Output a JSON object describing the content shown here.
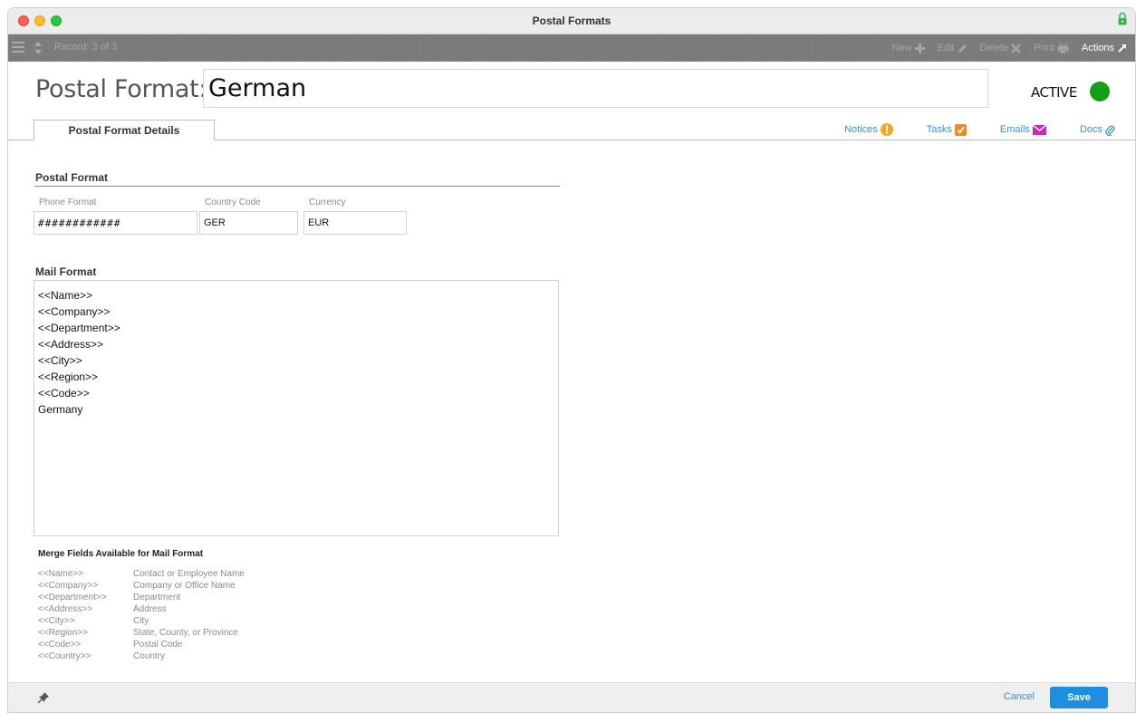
{
  "window": {
    "title": "Postal Formats"
  },
  "toolbar": {
    "record_text": "Record: 3 of 3",
    "new_label": "New",
    "edit_label": "Edit",
    "delete_label": "Delete",
    "print_label": "Print",
    "actions_label": "Actions"
  },
  "header": {
    "label": "Postal Format:",
    "name_value": "German",
    "status_label": "ACTIVE",
    "status_color": "#14a014"
  },
  "tabs": {
    "active_tab": "Postal Format Details",
    "links": [
      {
        "label": "Notices",
        "icon": "exclamation-icon",
        "color": "#f5a623"
      },
      {
        "label": "Tasks",
        "icon": "checkbox-icon",
        "color": "#f08a1c"
      },
      {
        "label": "Emails",
        "icon": "envelope-icon",
        "color": "#c12fb8"
      },
      {
        "label": "Docs",
        "icon": "paperclip-icon",
        "color": "#3e8fd6"
      }
    ]
  },
  "postal_format": {
    "section_title": "Postal Format",
    "phone_format_label": "Phone Format",
    "phone_format_value": "############",
    "country_code_label": "Country Code",
    "country_code_value": "GER",
    "currency_label": "Currency",
    "currency_value": "EUR"
  },
  "mail_format": {
    "section_title": "Mail Format",
    "lines": [
      "<<Name>>",
      "<<Company>>",
      "<<Department>>",
      "<<Address>>",
      "<<City>>",
      "<<Region>>",
      "<<Code>>",
      "Germany"
    ]
  },
  "merge_fields": {
    "title": "Merge Fields Available for Mail Format",
    "rows": [
      {
        "key": "<<Name>>",
        "desc": "Contact or Employee Name"
      },
      {
        "key": "<<Company>>",
        "desc": "Company or Office Name"
      },
      {
        "key": "<<Department>>",
        "desc": "Department"
      },
      {
        "key": "<<Address>>",
        "desc": "Address"
      },
      {
        "key": "<<City>>",
        "desc": "City"
      },
      {
        "key": "<<Region>>",
        "desc": "State, County, or Province"
      },
      {
        "key": "<<Code>>",
        "desc": "Postal Code"
      },
      {
        "key": "<<Country>>",
        "desc": "Country"
      }
    ]
  },
  "footer": {
    "cancel_label": "Cancel",
    "save_label": "Save",
    "accent_color": "#1e8fe0"
  }
}
